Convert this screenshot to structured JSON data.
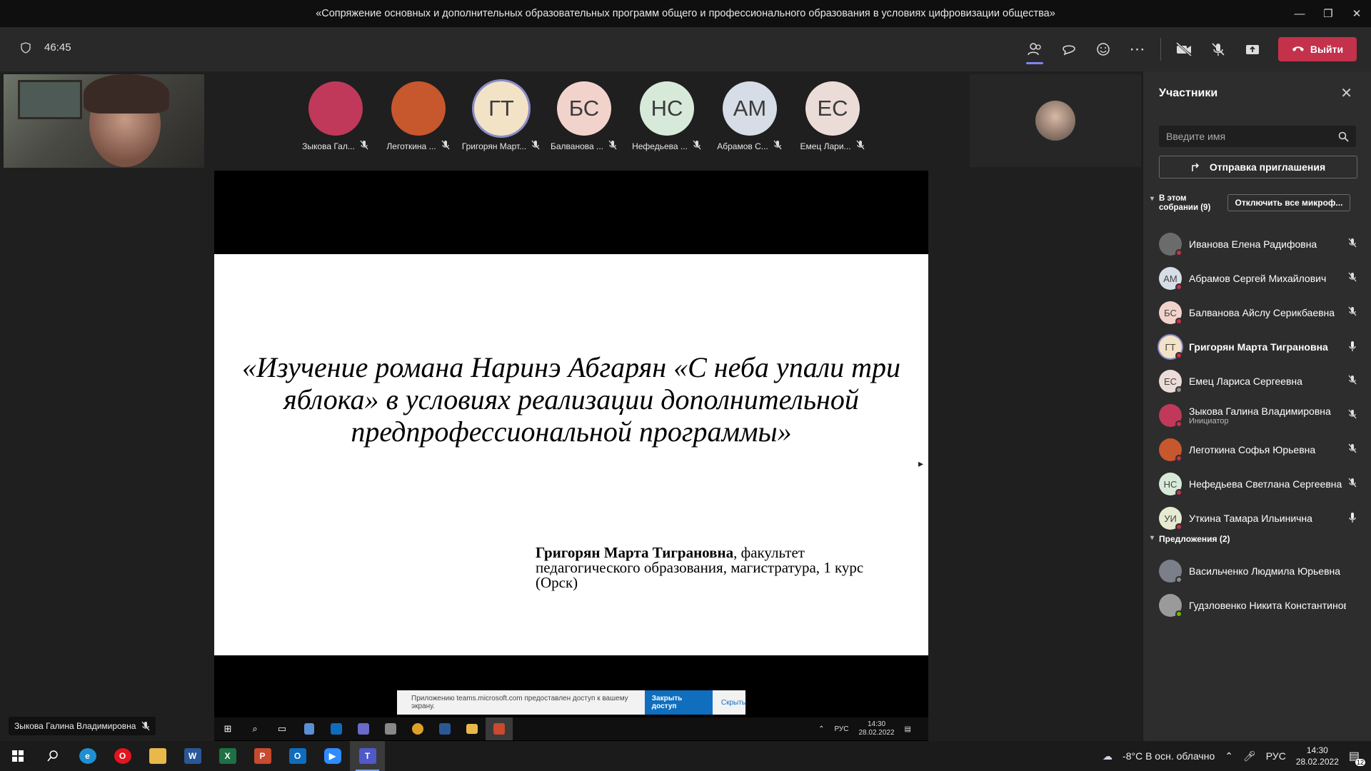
{
  "window": {
    "title": "«Сопряжение основных и дополнительных образовательных программ общего и профессионального образования в условиях цифровизации общества»"
  },
  "meeting": {
    "timer": "46:45",
    "leave_label": "Выйти"
  },
  "gallery": [
    {
      "name": "Зыкова Гал...",
      "initials": "",
      "color": "#c0395a"
    },
    {
      "name": "Леготкина ...",
      "initials": "",
      "color": "#c7572c"
    },
    {
      "name": "Григорян Март...",
      "initials": "ГТ",
      "color": "#f3e3c6"
    },
    {
      "name": "Балванова ...",
      "initials": "БС",
      "color": "#f2d3cc"
    },
    {
      "name": "Нефедьева ...",
      "initials": "НС",
      "color": "#d7ead9"
    },
    {
      "name": "Абрамов С...",
      "initials": "АМ",
      "color": "#d6dde6"
    },
    {
      "name": "Емец Лари...",
      "initials": "ЕС",
      "color": "#ecdcd8"
    }
  ],
  "slide": {
    "title": "«Изучение романа Наринэ Абгарян «С неба упали три яблока» в условиях реализации дополнительной предпрофессиональной программы»",
    "author_bold": "Григорян Марта Тиграновна",
    "author_rest": ", факультет педагогического образования, магистратура, 1 курс (Орск)"
  },
  "share_notice": {
    "text": "Приложению teams.microsoft.com предоставлен доступ к вашему экрану.",
    "stop_label": "Закрыть доступ",
    "hide_label": "Скрыть"
  },
  "inner_taskbar": {
    "lang": "РУС",
    "time": "14:30",
    "date": "28.02.2022"
  },
  "speaker_label": "Зыкова Галина Владимировна",
  "panel": {
    "title": "Участники",
    "search_placeholder": "Введите имя",
    "invite_label": "Отправка приглашения",
    "in_meeting_label": "В этом собрании (9)",
    "mute_all_label": "Отключить все микроф...",
    "participants": [
      {
        "name": "Иванова Елена Радифовна",
        "role": "",
        "initials": "",
        "color": "#6b6b6b",
        "mic": "muted",
        "bold": false
      },
      {
        "name": "Абрамов Сергей Михайлович",
        "role": "",
        "initials": "АМ",
        "color": "#d6dde6",
        "mic": "muted",
        "bold": false
      },
      {
        "name": "Балванова Айслу Серикбаевна",
        "role": "",
        "initials": "БС",
        "color": "#f2d3cc",
        "mic": "muted",
        "bold": false
      },
      {
        "name": "Григорян Марта Тиграновна",
        "role": "",
        "initials": "ГТ",
        "color": "#f3e3c6",
        "mic": "on",
        "bold": true
      },
      {
        "name": "Емец Лариса Сергеевна",
        "role": "",
        "initials": "ЕС",
        "color": "#ecdcd8",
        "mic": "muted",
        "bold": false
      },
      {
        "name": "Зыкова Галина Владимировна",
        "role": "Инициатор",
        "initials": "",
        "color": "#c0395a",
        "mic": "muted",
        "bold": false
      },
      {
        "name": "Леготкина Софья Юрьевна",
        "role": "",
        "initials": "",
        "color": "#c7572c",
        "mic": "muted",
        "bold": false
      },
      {
        "name": "Нефедьева Светлана Сергеевна",
        "role": "",
        "initials": "НС",
        "color": "#d7ead9",
        "mic": "muted",
        "bold": false
      },
      {
        "name": "Уткина Тамара Ильинична",
        "role": "",
        "initials": "УИ",
        "color": "#e6ead0",
        "mic": "on",
        "bold": false
      }
    ],
    "suggestions_label": "Предложения (2)",
    "suggestions": [
      {
        "name": "Васильченко Людмила Юрьевна",
        "initials": "",
        "color": "#7a7f8a"
      },
      {
        "name": "Гудзловенко Никита Константинов...",
        "initials": "",
        "color": "#9a9a9a"
      }
    ]
  },
  "taskbar": {
    "weather": "-8°C  В осн. облачно",
    "lang": "РУС",
    "time": "14:30",
    "date": "28.02.2022",
    "notif_count": "12"
  },
  "colors": {
    "accent": "#7f85f5",
    "leave": "#c4314b",
    "status_red": "#c4314b",
    "status_green": "#6bb700"
  }
}
